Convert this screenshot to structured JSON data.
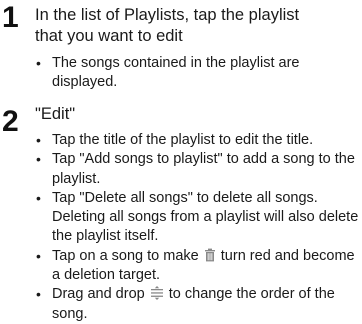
{
  "steps": [
    {
      "number": "1",
      "title_line1": "In the list of Playlists, tap the playlist",
      "title_line2": "that you want to edit",
      "bullets": [
        "The songs contained in the playlist are displayed."
      ]
    },
    {
      "number": "2",
      "title_line1": "\"Edit\"",
      "bullets": [
        "Tap the title of the playlist to edit the title.",
        "Tap \"Add songs to playlist\" to add a song to the playlist.",
        "Tap \"Delete all songs\" to delete all songs. Deleting all songs from a playlist will also delete the playlist itself.",
        {
          "before": "Tap on a song to make",
          "icon": "trash-icon",
          "after": "turn red and become a deletion target."
        },
        {
          "before": "Drag and drop",
          "icon": "reorder-icon",
          "after": "to change the order of the song."
        }
      ]
    }
  ],
  "colors": {
    "text": "#1a1a1a",
    "icon": "#888888"
  }
}
